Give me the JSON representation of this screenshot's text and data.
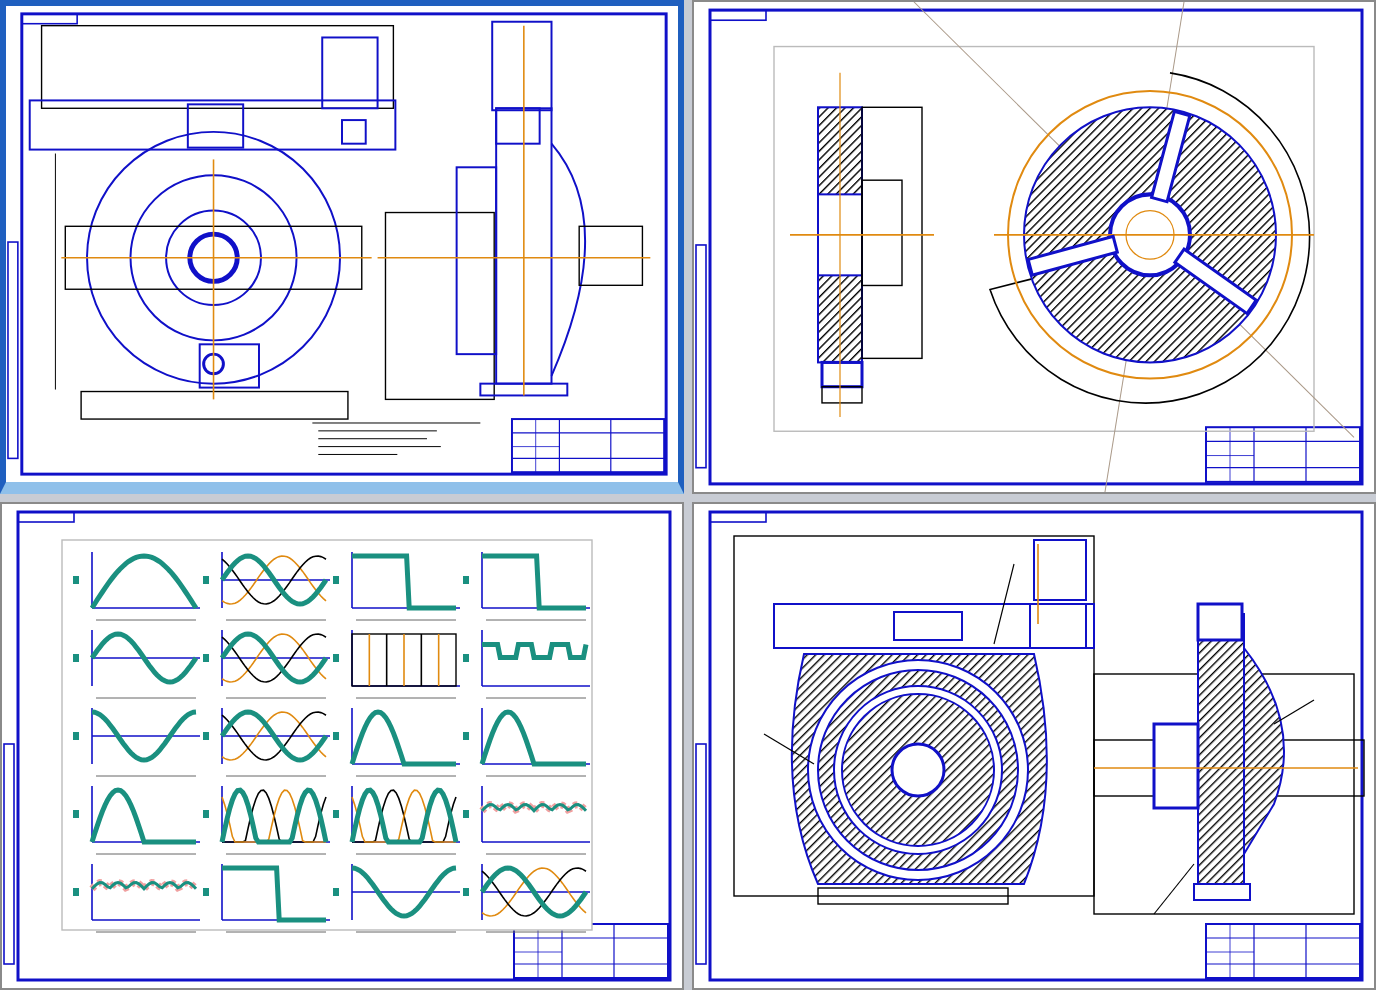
{
  "sheets": [
    {
      "kind": "assembly",
      "selected": true
    },
    {
      "kind": "gear",
      "selected": false
    },
    {
      "kind": "waveforms",
      "selected": false,
      "plots": [
        {
          "kind": "hump"
        },
        {
          "kind": "three-phase"
        },
        {
          "kind": "step"
        },
        {
          "kind": "step"
        },
        {
          "kind": "sine"
        },
        {
          "kind": "three-phase"
        },
        {
          "kind": "bars"
        },
        {
          "kind": "pulses"
        },
        {
          "kind": "cosine"
        },
        {
          "kind": "three-phase"
        },
        {
          "kind": "half-wave"
        },
        {
          "kind": "half-wave"
        },
        {
          "kind": "half-wave"
        },
        {
          "kind": "three-humps"
        },
        {
          "kind": "three-humps"
        },
        {
          "kind": "ripple"
        },
        {
          "kind": "ripple"
        },
        {
          "kind": "step"
        },
        {
          "kind": "cosine"
        },
        {
          "kind": "three-phase"
        }
      ]
    },
    {
      "kind": "section",
      "selected": false
    }
  ]
}
